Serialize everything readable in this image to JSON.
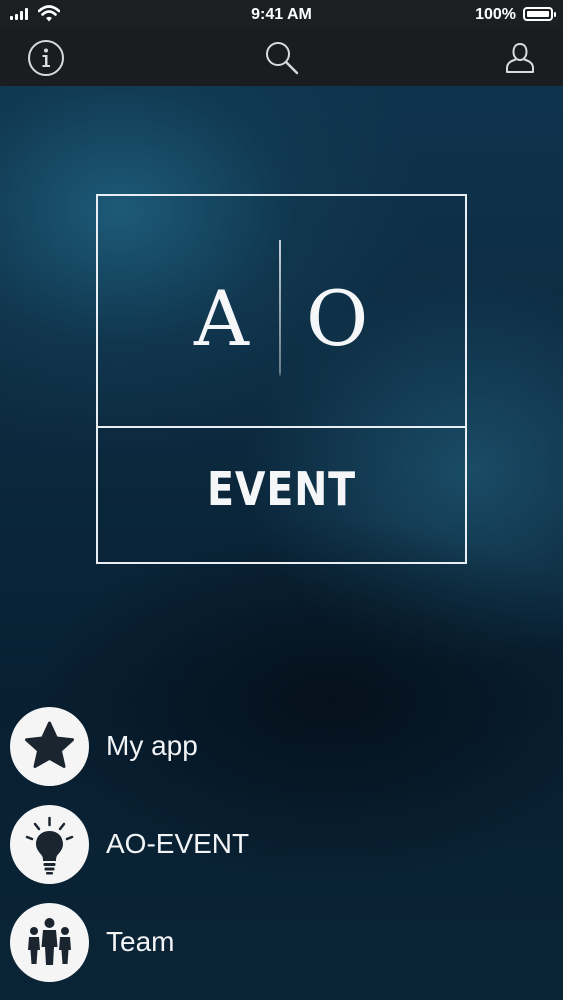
{
  "status_bar": {
    "time": "9:41 AM",
    "battery_percent": "100%",
    "icons": [
      "signal-icon",
      "wifi-icon",
      "battery-icon"
    ]
  },
  "nav_bar": {
    "icons": [
      "info-icon",
      "search-icon",
      "user-icon"
    ]
  },
  "logo": {
    "left_letter": "A",
    "right_letter": "O",
    "word": "EVENT"
  },
  "menu": {
    "items": [
      {
        "label": "My app",
        "icon": "star-icon"
      },
      {
        "label": "AO-EVENT",
        "icon": "lightbulb-icon"
      },
      {
        "label": "Team",
        "icon": "team-icon"
      }
    ]
  },
  "colors": {
    "bar_background": "#1a1d20",
    "background_dark": "#081f31",
    "background_light": "#1d5a78",
    "icon_circle": "#f5f5f5",
    "icon_fill": "#1a2530"
  }
}
